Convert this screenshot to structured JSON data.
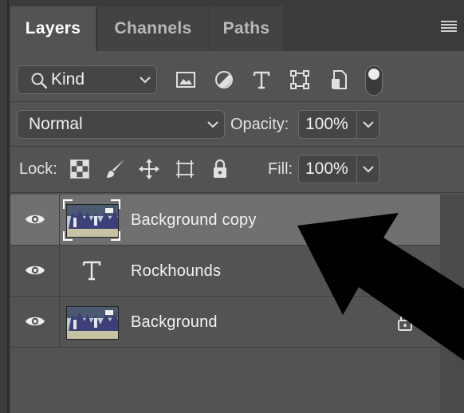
{
  "tabs": [
    {
      "label": "Layers",
      "active": true
    },
    {
      "label": "Channels",
      "active": false
    },
    {
      "label": "Paths",
      "active": false
    }
  ],
  "panel_menu_icon": "hamburger-icon",
  "filter": {
    "kind_label": "Kind",
    "icons": [
      "pixel-layer-filter-icon",
      "adjustment-layer-filter-icon",
      "type-layer-filter-icon",
      "shape-layer-filter-icon",
      "smart-object-filter-icon"
    ],
    "toggle_on": true
  },
  "blend": {
    "mode": "Normal",
    "opacity_label": "Opacity:",
    "opacity_value": "100%"
  },
  "lock": {
    "label": "Lock:",
    "icons": [
      "lock-transparent-pixels-icon",
      "lock-image-pixels-icon",
      "lock-position-icon",
      "lock-artboard-icon",
      "lock-all-icon"
    ],
    "fill_label": "Fill:",
    "fill_value": "100%"
  },
  "layers": [
    {
      "name": "Background copy",
      "type": "image",
      "visible": true,
      "selected": true,
      "locked": false
    },
    {
      "name": "Rockhounds",
      "type": "text",
      "visible": true,
      "selected": false,
      "locked": false
    },
    {
      "name": "Background",
      "type": "image",
      "visible": true,
      "selected": false,
      "locked": true
    }
  ],
  "colors": {
    "panel_bg": "#535353",
    "selected_row": "#707070",
    "tab_bar": "#3b3b3b"
  }
}
